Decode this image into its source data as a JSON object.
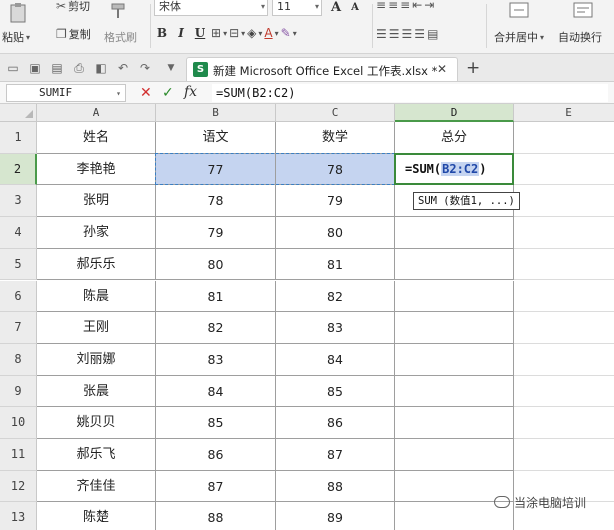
{
  "ribbon": {
    "clipboard": {
      "paste_label": "粘贴",
      "cut_label": "剪切",
      "copy_label": "复制",
      "format_painter_label": "格式刷"
    },
    "font": {
      "family": "宋体",
      "size": "11",
      "bold": "B",
      "italic": "I",
      "underline": "U",
      "grow": "A",
      "shrink": "A"
    },
    "alignment": {
      "merge_center_label": "合并居中",
      "wrap_label": "自动换行"
    }
  },
  "tabbar": {
    "document_title": "新建 Microsoft Office Excel 工作表.xlsx *",
    "excel_badge": "S"
  },
  "formula_bar": {
    "name_box": "SUMIF",
    "fx_label": "fx",
    "formula": "=SUM(B2:C2)"
  },
  "grid": {
    "columns": [
      "A",
      "B",
      "C",
      "D",
      "E"
    ],
    "rows": [
      "1",
      "2",
      "3",
      "4",
      "5",
      "6",
      "7",
      "8",
      "9",
      "10",
      "11",
      "12",
      "13"
    ],
    "headers": [
      "姓名",
      "语文",
      "数学",
      "总分"
    ],
    "data": [
      [
        "李艳艳",
        "77",
        "78"
      ],
      [
        "张明",
        "78",
        "79"
      ],
      [
        "孙家",
        "79",
        "80"
      ],
      [
        "郝乐乐",
        "80",
        "81"
      ],
      [
        "陈晨",
        "81",
        "82"
      ],
      [
        "王刚",
        "82",
        "83"
      ],
      [
        "刘丽娜",
        "83",
        "84"
      ],
      [
        "张晨",
        "84",
        "85"
      ],
      [
        "姚贝贝",
        "85",
        "86"
      ],
      [
        "郝乐飞",
        "86",
        "87"
      ],
      [
        "齐佳佳",
        "87",
        "88"
      ],
      [
        "陈楚",
        "88",
        "89"
      ]
    ],
    "active_cell": {
      "formula_prefix": "=SUM(",
      "formula_ref": "B2:C2",
      "formula_suffix": ")"
    },
    "tooltip": "SUM (数值1, ...)"
  },
  "watermark": "当涂电脑培训",
  "colors": {
    "selection_fill": "#c5d4f0",
    "marquee": "#3a7fc4",
    "active_border": "#3a8a3a",
    "header_active": "#d6e6cf"
  }
}
